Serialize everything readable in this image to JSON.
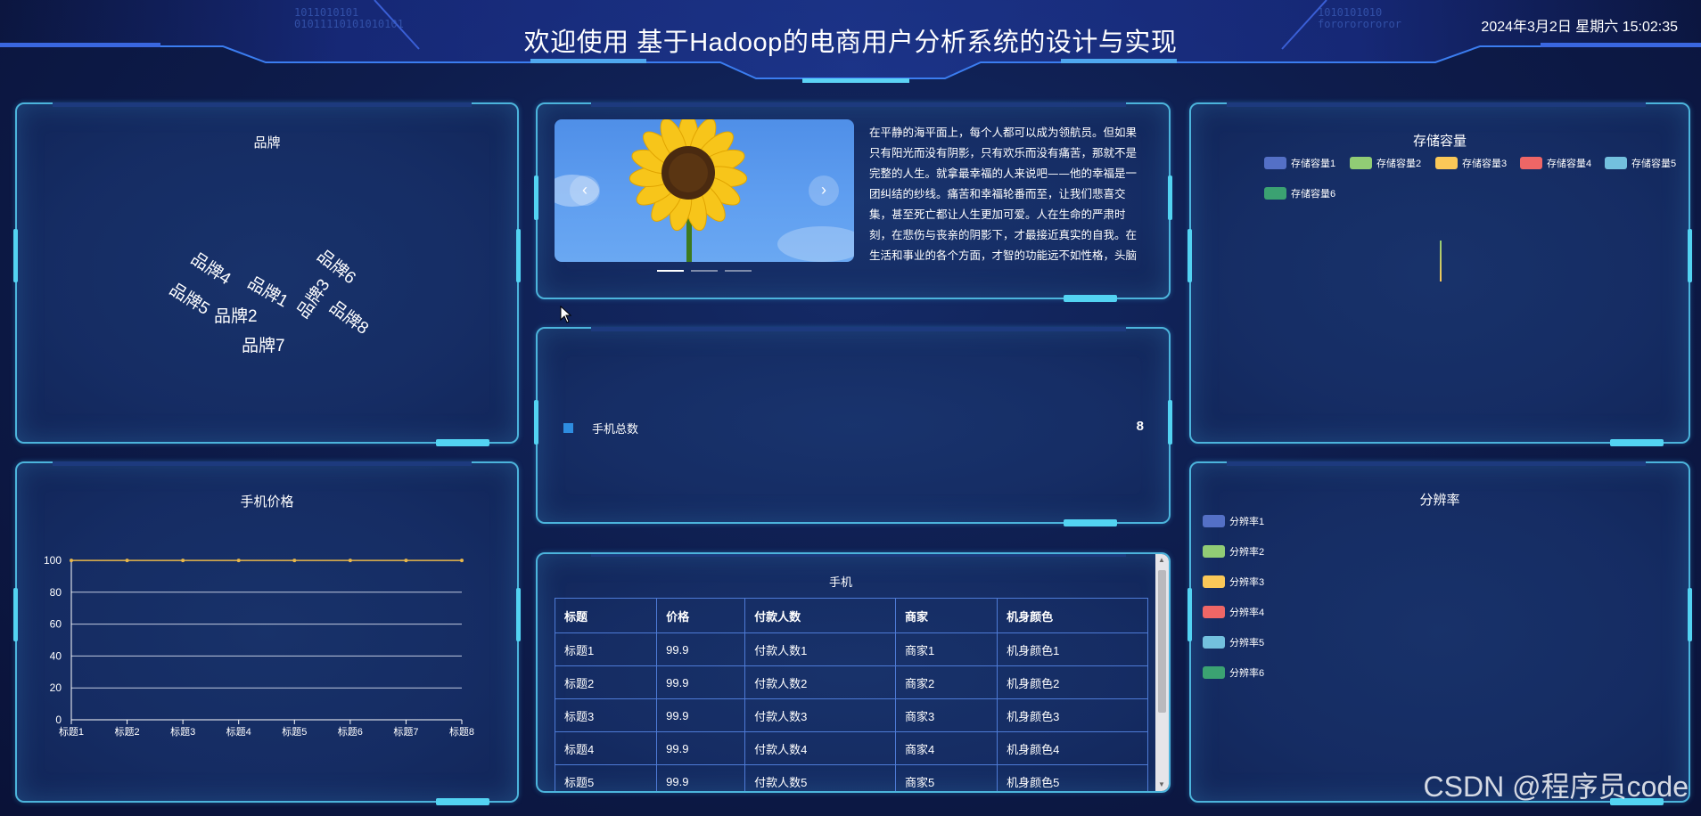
{
  "header": {
    "title": "欢迎使用 基于Hadoop的电商用户分析系统的设计与实现",
    "clock": "2024年3月2日 星期六 15:02:35",
    "binary_left": "1011010101\n01011110101010101",
    "binary_right": "1010101010\nforororororor"
  },
  "brand_panel": {
    "title": "品牌",
    "words": [
      {
        "text": "品牌4",
        "color": "#9acb7a"
      },
      {
        "text": "品牌6",
        "color": "#8a86f0"
      },
      {
        "text": "品牌1",
        "color": "#e8e8c0"
      },
      {
        "text": "品牌3",
        "color": "#8fa6c8"
      },
      {
        "text": "品牌5",
        "color": "#c9c3d8"
      },
      {
        "text": "品牌2",
        "color": "#d9d98a"
      },
      {
        "text": "品牌8",
        "color": "#e5e5f0"
      },
      {
        "text": "品牌7",
        "color": "#8bcf71"
      }
    ]
  },
  "price_panel": {
    "title": "手机价格",
    "chart_data": {
      "type": "line",
      "categories": [
        "标题1",
        "标题2",
        "标题3",
        "标题4",
        "标题5",
        "标题6",
        "标题7",
        "标题8"
      ],
      "series": [
        {
          "values": [
            99.9,
            99.9,
            99.9,
            99.9,
            99.9,
            99.9,
            99.9,
            99.9
          ],
          "color": "#e8b74a"
        }
      ],
      "yticks": [
        "0",
        "20",
        "40",
        "60",
        "80",
        "100"
      ],
      "ylim": [
        0,
        100
      ],
      "grid": true
    }
  },
  "carousel": {
    "prev_icon": "‹",
    "next_icon": "›",
    "paragraph": "在平静的海平面上，每个人都可以成为领航员。但如果只有阳光而没有阴影，只有欢乐而没有痛苦，那就不是完整的人生。就拿最幸福的人来说吧——他的幸福是一团纠结的纱线。痛苦和幸福轮番而至，让我们悲喜交集，甚至死亡都让人生更加可爱。人在生命的严肃时刻，在悲伤与丧亲的阴影下，才最接近真实的自我。在生活和事业的各个方面，才智的功能远不如性格，头脑的功能远不如心"
  },
  "phone_total": {
    "label": "手机总数",
    "value": "8",
    "color": "#2e8de0"
  },
  "phone_table": {
    "title": "手机",
    "columns": [
      "标题",
      "价格",
      "付款人数",
      "商家",
      "机身颜色"
    ],
    "rows": [
      [
        "标题1",
        "99.9",
        "付款人数1",
        "商家1",
        "机身颜色1"
      ],
      [
        "标题2",
        "99.9",
        "付款人数2",
        "商家2",
        "机身颜色2"
      ],
      [
        "标题3",
        "99.9",
        "付款人数3",
        "商家3",
        "机身颜色3"
      ],
      [
        "标题4",
        "99.9",
        "付款人数4",
        "商家4",
        "机身颜色4"
      ],
      [
        "标题5",
        "99.9",
        "付款人数5",
        "商家5",
        "机身颜色5"
      ]
    ]
  },
  "storage_panel": {
    "title": "存储容量",
    "legend": [
      {
        "label": "存储容量1",
        "color": "#5470c6"
      },
      {
        "label": "存储容量2",
        "color": "#91cc75"
      },
      {
        "label": "存储容量3",
        "color": "#fac858"
      },
      {
        "label": "存储容量4",
        "color": "#ee6666"
      },
      {
        "label": "存储容量5",
        "color": "#73c0de"
      },
      {
        "label": "存储容量6",
        "color": "#3ba272"
      }
    ]
  },
  "resolution_panel": {
    "title": "分辨率",
    "legend": [
      {
        "label": "分辨率1",
        "color": "#5470c6"
      },
      {
        "label": "分辨率2",
        "color": "#91cc75"
      },
      {
        "label": "分辨率3",
        "color": "#fac858"
      },
      {
        "label": "分辨率4",
        "color": "#ee6666"
      },
      {
        "label": "分辨率5",
        "color": "#73c0de"
      },
      {
        "label": "分辨率6",
        "color": "#3ba272"
      }
    ]
  },
  "watermark": "CSDN @程序员code"
}
